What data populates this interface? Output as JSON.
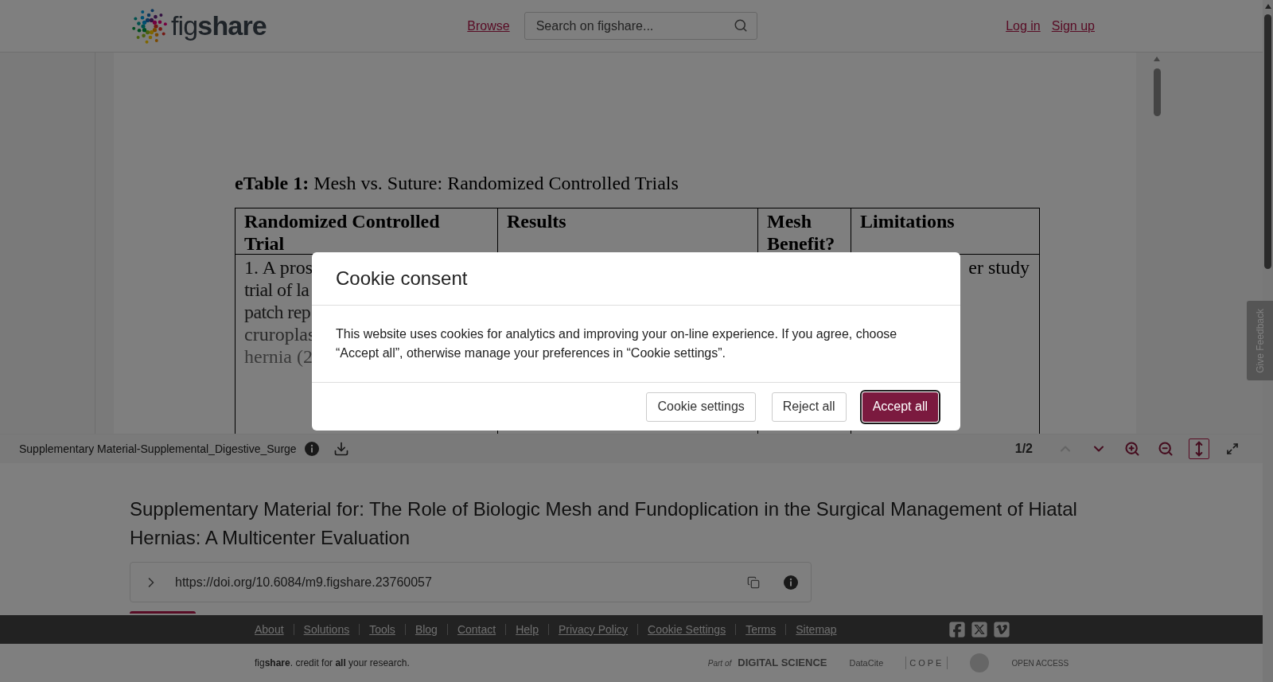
{
  "header": {
    "logo": "fig**share**",
    "nav": [
      {
        "label": "Browse"
      }
    ],
    "search": {
      "placeholder": "Search on figshare..."
    },
    "auth": [
      {
        "label": "Log in"
      },
      {
        "label": "Sign up"
      }
    ]
  },
  "viewer": {
    "document": {
      "caption": "**eTable 1:** Mesh vs. Suture: Randomized Controlled Trials",
      "columns": [
        "Randomized Controlled Trial",
        "Results",
        "Mesh Benefit?",
        "Limitations"
      ],
      "row_1": {
        "column_1": [
          "1. A pros",
          "trial of la",
          "patch rep",
          "cruroplas",
          "hernia (2"
        ],
        "column_4": "er study"
      }
    },
    "toolbar": {
      "filename": "Supplementary Material-Supplemental_Digestive_Surge",
      "page": "1/2",
      "controls": [
        {
          "kind": "previous-page",
          "disabled": true,
          "selected": false
        },
        {
          "kind": "next-page",
          "disabled": false,
          "selected": false
        },
        {
          "kind": "zoom-in",
          "disabled": false,
          "selected": false
        },
        {
          "kind": "zoom-out",
          "disabled": false,
          "selected": false
        },
        {
          "kind": "fit-height",
          "disabled": false,
          "selected": true
        },
        {
          "kind": "fullscreen",
          "disabled": false,
          "selected": false
        }
      ]
    }
  },
  "feedback_tab": "Give Feedback",
  "item": {
    "title": "Supplementary Material for: The Role of Biologic Mesh and Fundoplication in the Surgical Management of Hiatal Hernias: A Multicenter Evaluation",
    "doi": "https://doi.org/10.6084/m9.figshare.23760057"
  },
  "footer": {
    "links": [
      "About",
      "Solutions",
      "Tools",
      "Blog",
      "Contact",
      "Help",
      "Privacy Policy",
      "Cookie Settings",
      "Terms",
      "Sitemap"
    ],
    "tagline": "fig**share**. credit for **all** your research.",
    "partners": [
      "Part of",
      "DIGITAL SCIENCE",
      "DataCite",
      "COPE",
      "OPEN ACCESS"
    ]
  },
  "cookie_dialog": {
    "title": "Cookie consent",
    "message": "This website uses cookies for analytics and improving your on-line experience. If you agree, choose “Accept all”, otherwise manage your preferences in “Cookie settings”.",
    "buttons": [
      {
        "label": "Cookie settings",
        "primary": false
      },
      {
        "label": "Reject all",
        "primary": false
      },
      {
        "label": "Accept all",
        "primary": true
      }
    ]
  }
}
